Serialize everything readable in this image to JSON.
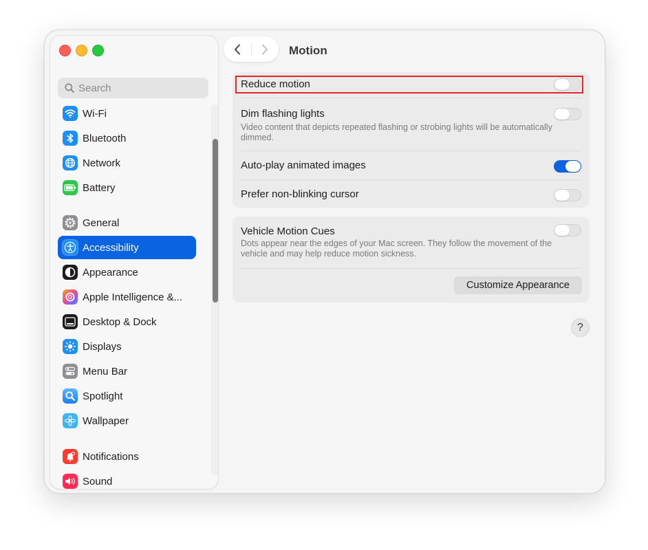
{
  "window": {
    "title": "Motion"
  },
  "search": {
    "placeholder": "Search"
  },
  "sidebar": {
    "items": [
      {
        "label": "Wi-Fi",
        "icon": "wifi-icon",
        "color": "#1e8ef5"
      },
      {
        "label": "Bluetooth",
        "icon": "bluetooth-icon",
        "color": "#1e8ef5"
      },
      {
        "label": "Network",
        "icon": "globe-icon",
        "color": "#1e8ef5"
      },
      {
        "label": "Battery",
        "icon": "battery-icon",
        "color": "#30c54d"
      },
      {
        "label": "General",
        "icon": "gear-icon",
        "color": "#8e8e93"
      },
      {
        "label": "Accessibility",
        "icon": "accessibility-icon",
        "color": "#1e8ef5",
        "selected": true
      },
      {
        "label": "Appearance",
        "icon": "appearance-icon",
        "color": "#1c1c1e"
      },
      {
        "label": "Apple Intelligence &...",
        "icon": "apple-intelligence-icon",
        "color": "#e86a9a"
      },
      {
        "label": "Desktop & Dock",
        "icon": "dock-icon",
        "color": "#1c1c1e"
      },
      {
        "label": "Displays",
        "icon": "sun-icon",
        "color": "#1e8ef5"
      },
      {
        "label": "Menu Bar",
        "icon": "menu-bar-icon",
        "color": "#8e8e93"
      },
      {
        "label": "Spotlight",
        "icon": "magnifier-icon",
        "color": "#1e8ef5"
      },
      {
        "label": "Wallpaper",
        "icon": "flower-icon",
        "color": "#3fb5f0"
      },
      {
        "label": "Notifications",
        "icon": "bell-icon",
        "color": "#ff3b30"
      },
      {
        "label": "Sound",
        "icon": "speaker-icon",
        "color": "#ff2d55"
      }
    ]
  },
  "settings": {
    "reduce_motion": {
      "label": "Reduce motion",
      "on": false
    },
    "dim_flashing": {
      "label": "Dim flashing lights",
      "desc": "Video content that depicts repeated flashing or strobing lights will be automatically dimmed.",
      "on": false
    },
    "autoplay": {
      "label": "Auto-play animated images",
      "on": true
    },
    "cursor": {
      "label": "Prefer non-blinking cursor",
      "on": false
    },
    "vehicle": {
      "label": "Vehicle Motion Cues",
      "desc": "Dots appear near the edges of your Mac screen. They follow the movement of the vehicle and may help reduce motion sickness.",
      "on": false
    },
    "customize_button": "Customize Appearance"
  },
  "help": "?",
  "colors": {
    "accent": "#0a63e0",
    "highlight": "#e1252a"
  }
}
